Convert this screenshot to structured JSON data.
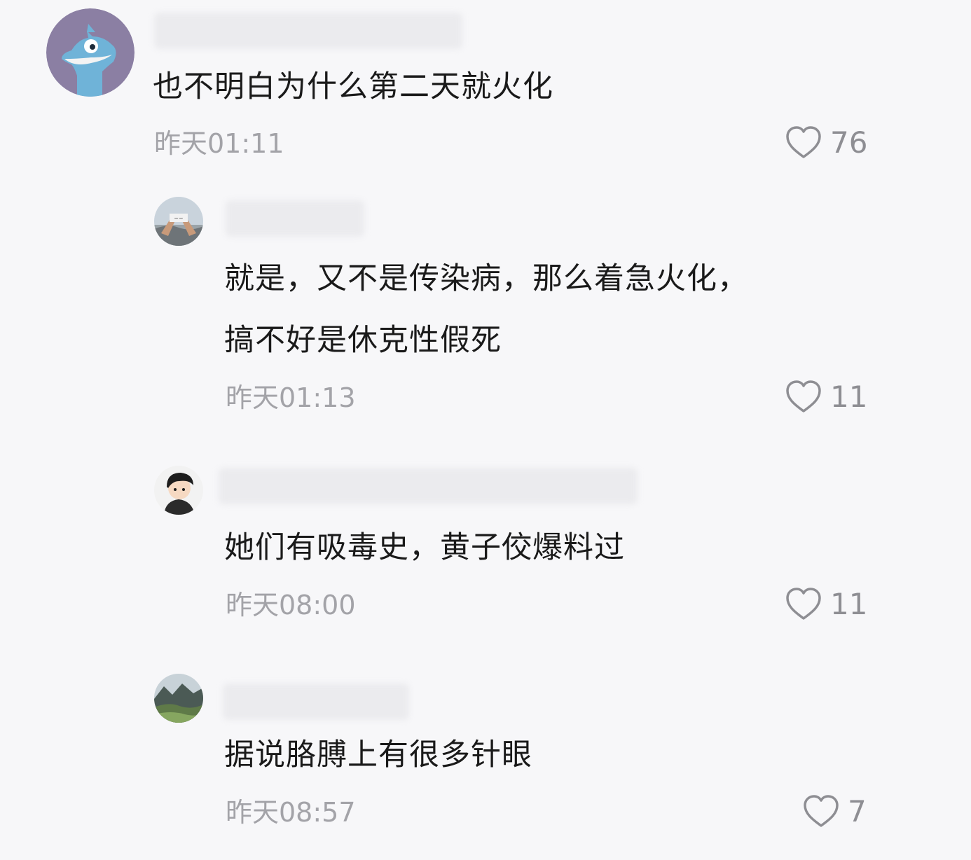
{
  "comments": [
    {
      "avatar": "blue-monster-avatar",
      "text": "也不明白为什么第二天就火化",
      "time": "昨天01:11",
      "likes": "76"
    },
    {
      "avatar": "hands-sky-avatar",
      "text_line1": "就是，又不是传染病，那么着急火化，",
      "text_line2": "搞不好是休克性假死",
      "time": "昨天01:13",
      "likes": "11"
    },
    {
      "avatar": "cartoon-person-avatar",
      "text": "她们有吸毒史，黄子佼爆料过",
      "time": "昨天08:00",
      "likes": "11"
    },
    {
      "avatar": "landscape-avatar",
      "text": "据说胳膊上有很多针眼",
      "time": "昨天08:57",
      "likes": "7"
    }
  ],
  "icons": {
    "like": "heart-outline-icon"
  },
  "colors": {
    "background": "#f7f7f9",
    "text": "#1a1a1a",
    "meta": "#a3a3a8",
    "like": "#8e8e93",
    "avatar_bg_1": "#8b7fa3",
    "monster_blue": "#6fb3d8"
  }
}
